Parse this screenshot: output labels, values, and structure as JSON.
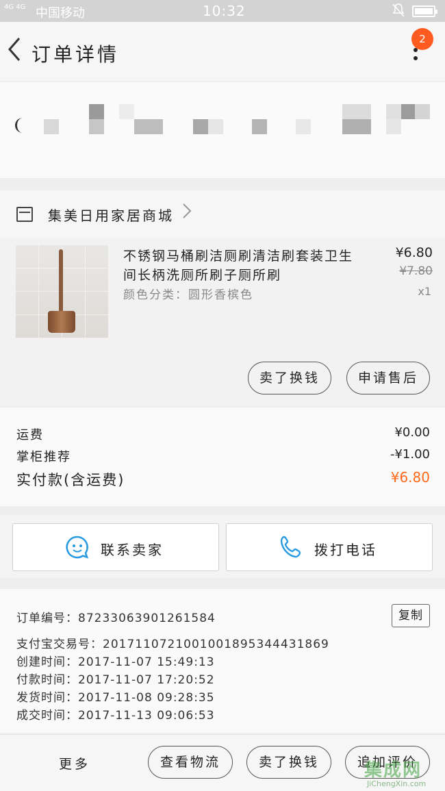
{
  "status_bar": {
    "signal": "4G 4G",
    "carrier": "中国移动",
    "time": "10:32"
  },
  "nav": {
    "back_icon": "chevron-left-icon",
    "title": "订单详情",
    "menu_badge": "2"
  },
  "shop": {
    "icon": "store-icon",
    "name": "集美日用家居商城"
  },
  "product": {
    "name": "不锈钢马桶刷洁厕刷清洁刷套装卫生间长柄洗厕所刷子厕所刷",
    "sku": "颜色分类：圆形香槟色",
    "price": "¥6.80",
    "original_price": "¥7.80",
    "quantity": "x1",
    "buttons": [
      "卖了换钱",
      "申请售后"
    ]
  },
  "fees": {
    "shipping_label": "运费",
    "shipping_value": "¥0.00",
    "discount_label": "掌柜推荐",
    "discount_value": "-¥1.00",
    "total_label": "实付款(含运费)",
    "total_value": "¥6.80",
    "accent_color": "#ff6a1a"
  },
  "contact": {
    "seller_label": "联系卖家",
    "seller_icon": "chat-bubble-icon",
    "phone_label": "拨打电话",
    "phone_icon": "phone-icon"
  },
  "order_info": {
    "order_no": "订单编号：87233063901261584",
    "copy_label": "复制",
    "alipay_no": "支付宝交易号：2017110721001001895344431869",
    "created": "创建时间：2017-11-07 15:49:13",
    "paid": "付款时间：2017-11-07 17:20:52",
    "shipped": "发货时间：2017-11-08 09:28:35",
    "completed": "成交时间：2017-11-13 09:06:53"
  },
  "bottom_bar": {
    "more": "更多",
    "logistics": "查看物流",
    "resell": "卖了换钱",
    "review": "追加评价"
  },
  "watermark": {
    "top": "集成网",
    "bottom": "JiChengXin.com"
  }
}
